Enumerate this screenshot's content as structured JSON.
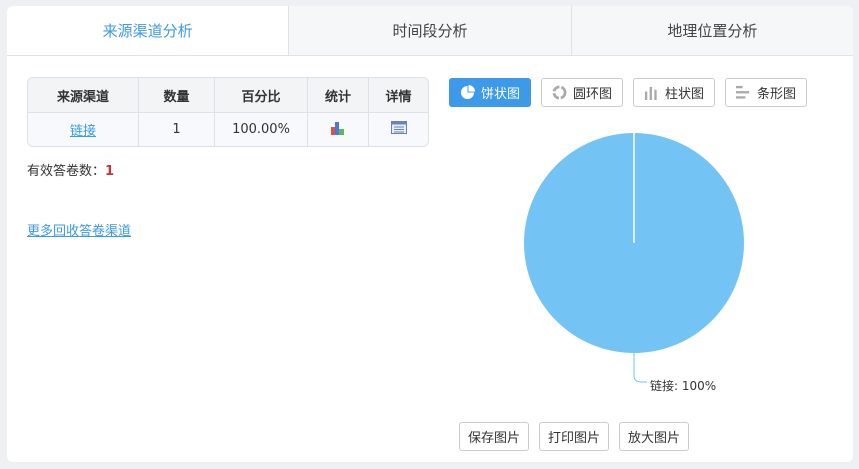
{
  "tabs": [
    "来源渠道分析",
    "时间段分析",
    "地理位置分析"
  ],
  "table": {
    "headers": [
      "来源渠道",
      "数量",
      "百分比",
      "统计",
      "详情"
    ],
    "rows": [
      {
        "channel": "链接",
        "count": "1",
        "percent": "100.00%"
      }
    ]
  },
  "valid": {
    "label": "有效答卷数：",
    "value": "1"
  },
  "more_link": "更多回收答卷渠道",
  "chart_types": [
    "饼状图",
    "圆环图",
    "柱状图",
    "条形图"
  ],
  "actions": [
    "保存图片",
    "打印图片",
    "放大图片"
  ],
  "colors": {
    "accent": "#3c9ae8",
    "pie": "#73c4f5"
  },
  "chart_data": {
    "type": "pie",
    "slices": [
      {
        "name": "链接",
        "value": 100
      }
    ],
    "label": "链接: 100%"
  }
}
